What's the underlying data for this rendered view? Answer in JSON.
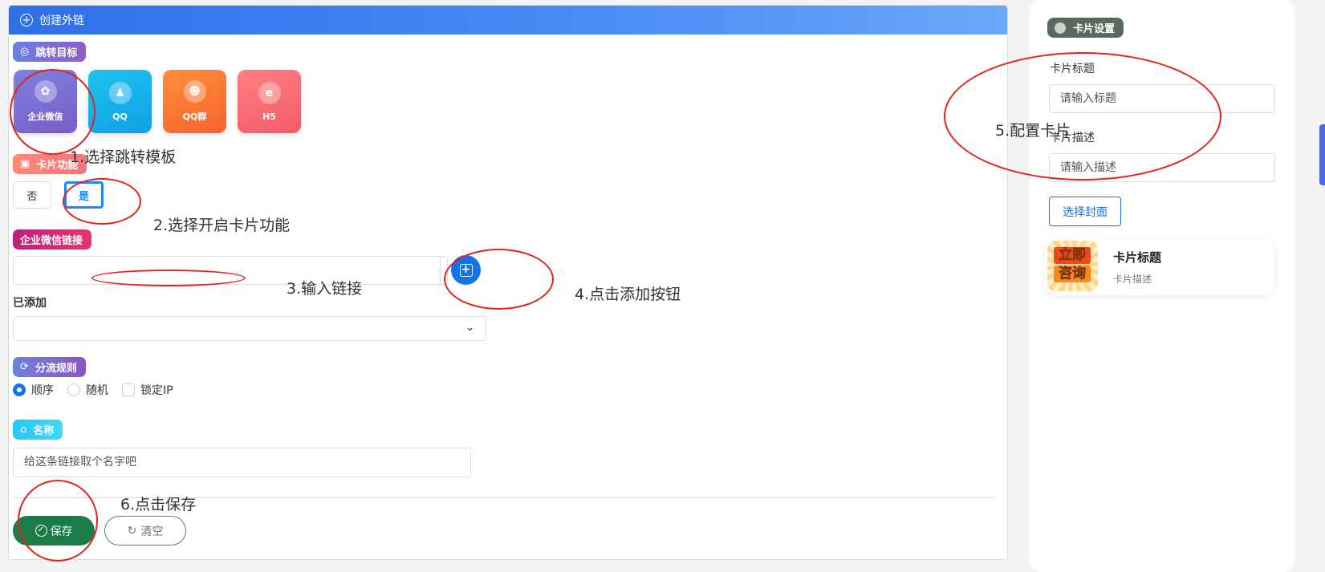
{
  "header": {
    "title": "创建外链"
  },
  "jump_target": {
    "label": "跳转目标",
    "options": [
      {
        "label": "企业微信",
        "icon": "wechat-work-icon"
      },
      {
        "label": "QQ",
        "icon": "qq-icon"
      },
      {
        "label": "QQ群",
        "icon": "qq-group-icon"
      },
      {
        "label": "H5",
        "icon": "h5-browser-icon"
      }
    ],
    "selected": "企业微信"
  },
  "card_feature": {
    "label": "卡片功能",
    "no": "否",
    "yes": "是",
    "selected": "是"
  },
  "wx_link": {
    "label": "企业微信链接",
    "value": ""
  },
  "added": {
    "label": "已添加",
    "value": ""
  },
  "split_rule": {
    "label": "分流规则",
    "options": [
      "顺序",
      "随机",
      "锁定IP"
    ],
    "selected": "顺序"
  },
  "name_field": {
    "label": "名称",
    "placeholder": "给这条链接取个名字吧"
  },
  "actions": {
    "save": "保存",
    "clear": "清空"
  },
  "card_settings": {
    "label": "卡片设置",
    "title_label": "卡片标题",
    "title_placeholder": "请输入标题",
    "desc_label": "卡片描述",
    "desc_placeholder": "请输入描述",
    "cover_button": "选择封面",
    "preview": {
      "title": "卡片标题",
      "desc": "卡片描述",
      "thumb_line1": "立即",
      "thumb_line2": "咨询"
    }
  },
  "annotations": [
    "1.选择跳转模板",
    "2.选择开启卡片功能",
    "3.输入链接",
    "4.点击添加按钮",
    "5.配置卡片",
    "6.点击保存"
  ],
  "colors": {
    "header": "#2e6fe8",
    "primary": "#1473e6",
    "save": "#1b7c47",
    "annotation_circle": "#e3241b"
  }
}
